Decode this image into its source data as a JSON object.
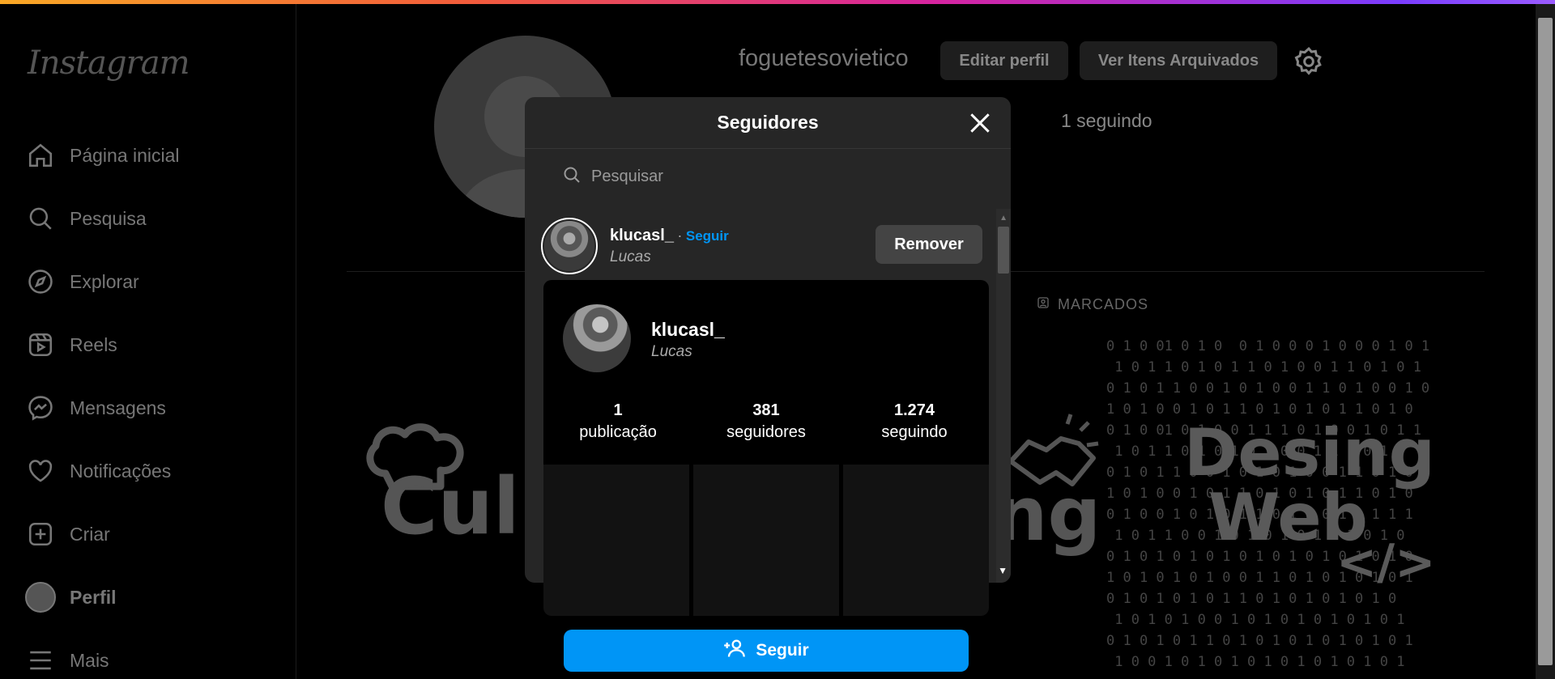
{
  "brand": {
    "logo": "Instagram"
  },
  "sidebar": {
    "items": [
      {
        "label": "Página inicial",
        "icon": "home-icon"
      },
      {
        "label": "Pesquisa",
        "icon": "search-icon"
      },
      {
        "label": "Explorar",
        "icon": "compass-icon"
      },
      {
        "label": "Reels",
        "icon": "reels-icon"
      },
      {
        "label": "Mensagens",
        "icon": "messenger-icon"
      },
      {
        "label": "Notificações",
        "icon": "heart-icon"
      },
      {
        "label": "Criar",
        "icon": "plus-square-icon"
      },
      {
        "label": "Perfil",
        "icon": "avatar"
      },
      {
        "label": "Mais",
        "icon": "menu-icon"
      }
    ]
  },
  "profile": {
    "username": "foguetesovietico",
    "edit_label": "Editar perfil",
    "archive_label": "Ver Itens Arquivados",
    "following_text": "1 seguindo",
    "tagged_label": "MARCADOS"
  },
  "posts": {
    "tile1_text": "Culin",
    "tile2_text": "ng",
    "tile3_line1": "Desing",
    "tile3_line2": "Web",
    "tile3_code": "</>"
  },
  "modal": {
    "title": "Seguidores",
    "search_placeholder": "Pesquisar",
    "follower": {
      "username": "klucasl_",
      "separator": "·",
      "follow_link": "Seguir",
      "full_name": "Lucas",
      "remove_label": "Remover"
    }
  },
  "hover_card": {
    "username": "klucasl_",
    "full_name": "Lucas",
    "stats": [
      {
        "value": "1",
        "label": "publicação"
      },
      {
        "value": "381",
        "label": "seguidores"
      },
      {
        "value": "1.274",
        "label": "seguindo"
      }
    ],
    "follow_label": "Seguir"
  },
  "colors": {
    "accent": "#0095f6",
    "modal_bg": "#262626",
    "background": "#000000"
  }
}
